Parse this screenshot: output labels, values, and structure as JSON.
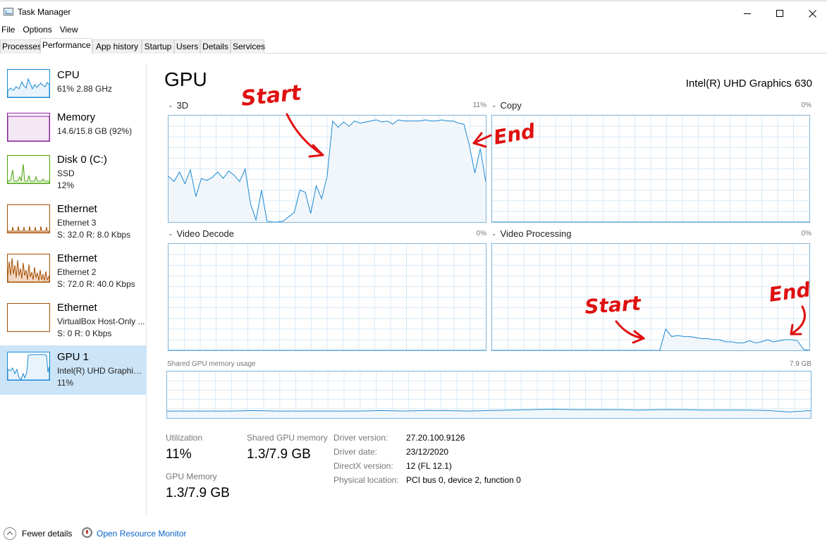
{
  "window": {
    "title": "Task Manager"
  },
  "menu": [
    "File",
    "Options",
    "View"
  ],
  "tabs": [
    "Processes",
    "Performance",
    "App history",
    "Startup",
    "Users",
    "Details",
    "Services"
  ],
  "active_tab": "Performance",
  "sidebar": [
    {
      "title": "CPU",
      "line1": "61%  2.88 GHz",
      "line2": "",
      "color": "#1a8ad4"
    },
    {
      "title": "Memory",
      "line1": "14.6/15.8 GB (92%)",
      "line2": "",
      "color": "#8b1d9e"
    },
    {
      "title": "Disk 0 (C:)",
      "line1": "SSD",
      "line2": "12%",
      "color": "#4da60c"
    },
    {
      "title": "Ethernet",
      "line1": "Ethernet 3",
      "line2": "S: 32.0  R: 8.0 Kbps",
      "color": "#a74f01"
    },
    {
      "title": "Ethernet",
      "line1": "Ethernet 2",
      "line2": "S: 72.0  R: 40.0 Kbps",
      "color": "#a74f01"
    },
    {
      "title": "Ethernet",
      "line1": "VirtualBox Host-Only ...",
      "line2": "S: 0  R: 0 Kbps",
      "color": "#a74f01"
    },
    {
      "title": "GPU 1",
      "line1": "Intel(R) UHD Graphics ...",
      "line2": "11%",
      "color": "#1a8ad4"
    }
  ],
  "gpu": {
    "heading": "GPU",
    "name": "Intel(R) UHD Graphics 630",
    "engines": [
      {
        "label": "3D",
        "percent": "11%"
      },
      {
        "label": "Copy",
        "percent": "0%"
      },
      {
        "label": "Video Decode",
        "percent": "0%"
      },
      {
        "label": "Video Processing",
        "percent": "0%"
      }
    ],
    "shared_label": "Shared GPU memory usage",
    "shared_max": "7.9 GB",
    "graph_color": "#1a8ad4",
    "graph_fill": "#f1f6fa"
  },
  "stats": {
    "utilization_label": "Utilization",
    "utilization": "11%",
    "shared_label": "Shared GPU memory",
    "shared": "1.3/7.9 GB",
    "gpu_memory_label": "GPU Memory",
    "gpu_memory": "1.3/7.9 GB"
  },
  "details": [
    {
      "label": "Driver version:",
      "value": "27.20.100.9126"
    },
    {
      "label": "Driver date:",
      "value": "23/12/2020"
    },
    {
      "label": "DirectX version:",
      "value": "12 (FL 12.1)"
    },
    {
      "label": "Physical location:",
      "value": "PCI bus 0, device 2, function 0"
    }
  ],
  "footer": {
    "fewer": "Fewer details",
    "resource_monitor": "Open Resource Monitor"
  },
  "annotations": {
    "start": "Start",
    "end": "End",
    "color": "#e01010"
  },
  "chart_data": [
    {
      "type": "area",
      "title": "3D",
      "ylim": [
        0,
        100
      ],
      "values": [
        43,
        38,
        47,
        36,
        49,
        24,
        41,
        39,
        42,
        47,
        41,
        48,
        44,
        38,
        50,
        17,
        2,
        30,
        1,
        0,
        0,
        1,
        5,
        9,
        30,
        28,
        8,
        34,
        22,
        43,
        95,
        89,
        94,
        90,
        95,
        93,
        94,
        95,
        96,
        94,
        95,
        92,
        96,
        95,
        95,
        95,
        95,
        96,
        95,
        95,
        96,
        95,
        95,
        93,
        92,
        72,
        46,
        69,
        38
      ]
    },
    {
      "type": "area",
      "title": "Copy",
      "ylim": [
        0,
        100
      ],
      "values": [
        0,
        0,
        0,
        0,
        0,
        0,
        0,
        0,
        0,
        0
      ]
    },
    {
      "type": "area",
      "title": "Video Decode",
      "ylim": [
        0,
        100
      ],
      "values": [
        0,
        0,
        0,
        0,
        0,
        0,
        0,
        0,
        0,
        0
      ]
    },
    {
      "type": "area",
      "title": "Video Processing",
      "ylim": [
        0,
        100
      ],
      "values": [
        0,
        0,
        0,
        0,
        0,
        0,
        0,
        0,
        0,
        0,
        0,
        0,
        0,
        0,
        0,
        0,
        0,
        0,
        0,
        0,
        0,
        0,
        0,
        0,
        0,
        0,
        0,
        0,
        0,
        20,
        13,
        14,
        13,
        13,
        12,
        11,
        11,
        10,
        10,
        8,
        8,
        7,
        7,
        9,
        7,
        8,
        10,
        8,
        9,
        10,
        10,
        9,
        1,
        0
      ]
    },
    {
      "type": "area",
      "title": "Shared GPU memory usage",
      "ylim": [
        0,
        100
      ],
      "values": [
        15,
        15,
        15,
        15,
        16,
        15,
        15,
        15,
        15,
        15,
        16,
        15,
        16,
        16,
        15,
        16,
        17,
        18,
        19,
        18,
        18,
        18,
        17,
        18,
        18,
        17,
        17,
        17,
        16,
        13,
        16
      ]
    }
  ]
}
